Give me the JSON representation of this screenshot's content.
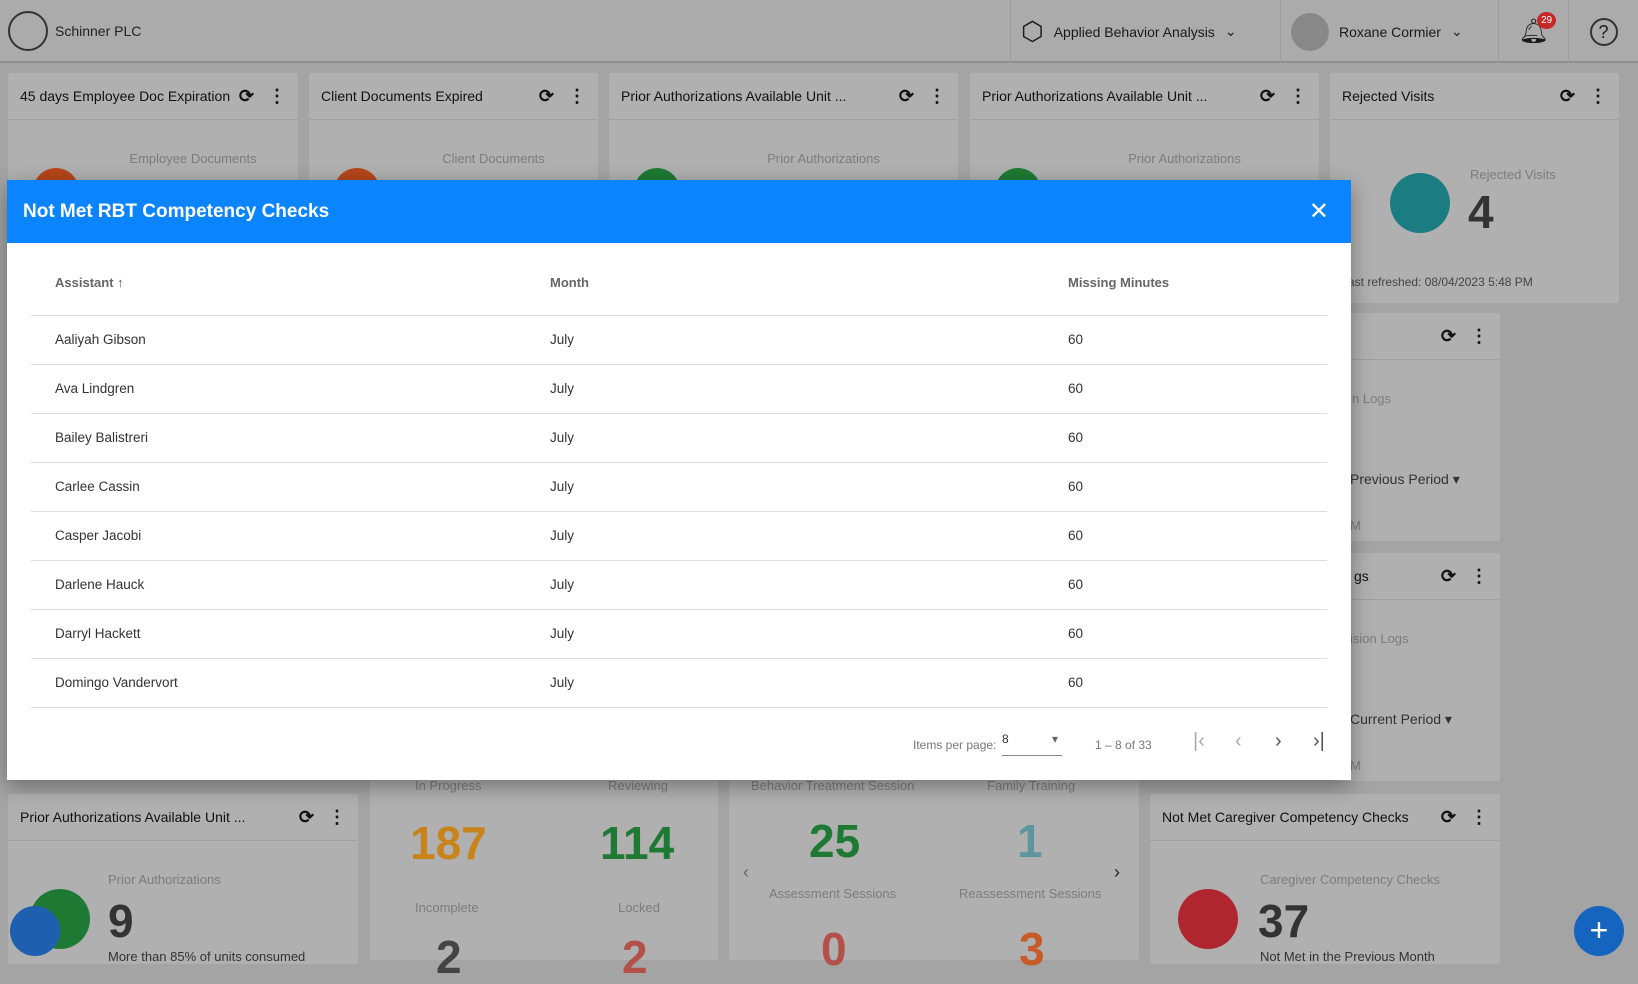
{
  "header": {
    "company": "Schinner PLC",
    "module": "Applied Behavior Analysis",
    "user": "Roxane Cormier",
    "notifications": "29"
  },
  "cards_top": [
    {
      "title": "45 days Employee Doc Expiration",
      "sub": "Employee Documents",
      "color": "#b5451a"
    },
    {
      "title": "Client Documents Expired",
      "sub": "Client Documents",
      "color": "#b5451a"
    },
    {
      "title": "Prior Authorizations Available Unit ...",
      "sub": "Prior Authorizations",
      "color": "#1e7a33"
    },
    {
      "title": "Prior Authorizations Available Unit ...",
      "sub": "Prior Authorizations",
      "color": "#1e7a33"
    },
    {
      "title": "Rejected Visits",
      "sub": "Rejected Visits",
      "value": "4",
      "refreshed": "ast refreshed: 08/04/2023 5:48 PM",
      "color": "#1b7c82"
    }
  ],
  "cards_right": [
    {
      "sub": "n Logs",
      "filter": "Previous Period",
      "foot": "M"
    },
    {
      "title": "gs",
      "sub": "ision Logs",
      "filter": "Current Period",
      "foot": "M"
    }
  ],
  "cards_bottom": {
    "prior": {
      "title": "Prior Authorizations Available Unit ...",
      "sub": "Prior Authorizations",
      "value": "9",
      "foot": "More than 85% of units consumed"
    },
    "notes": {
      "labels": [
        "In Progress",
        "Reviewing",
        "Incomplete",
        "Locked"
      ],
      "values": [
        "187",
        "114",
        "2",
        "2"
      ],
      "colors": [
        "#c8841a",
        "#1e7a33",
        "#444",
        "#b4504a"
      ]
    },
    "sessions": {
      "labels": [
        "Behavior Treatment Session",
        "Family Training",
        "Assessment Sessions",
        "Reassessment Sessions"
      ],
      "values": [
        "25",
        "1",
        "0",
        "3"
      ],
      "colors": [
        "#1e7a33",
        "#5e96a0",
        "#b4504a",
        "#c85a28"
      ]
    },
    "caregiver": {
      "title": "Not Met Caregiver Competency Checks",
      "sub": "Caregiver Competency Checks",
      "value": "37",
      "foot": "Not Met in the Previous Month"
    }
  },
  "modal": {
    "title": "Not Met RBT Competency Checks",
    "columns": [
      "Assistant",
      "Month",
      "Missing Minutes"
    ],
    "rows": [
      [
        "Aaliyah Gibson",
        "July",
        "60"
      ],
      [
        "Ava Lindgren",
        "July",
        "60"
      ],
      [
        "Bailey Balistreri",
        "July",
        "60"
      ],
      [
        "Carlee Cassin",
        "July",
        "60"
      ],
      [
        "Casper Jacobi",
        "July",
        "60"
      ],
      [
        "Darlene Hauck",
        "July",
        "60"
      ],
      [
        "Darryl Hackett",
        "July",
        "60"
      ],
      [
        "Domingo Vandervort",
        "July",
        "60"
      ]
    ],
    "pagination": {
      "items_label": "Items per page:",
      "per_page": "8",
      "range": "1 – 8 of 33"
    }
  },
  "colors": {
    "accent": "#0a84ff",
    "badge": "#c62828",
    "fab": "#1565c0"
  }
}
